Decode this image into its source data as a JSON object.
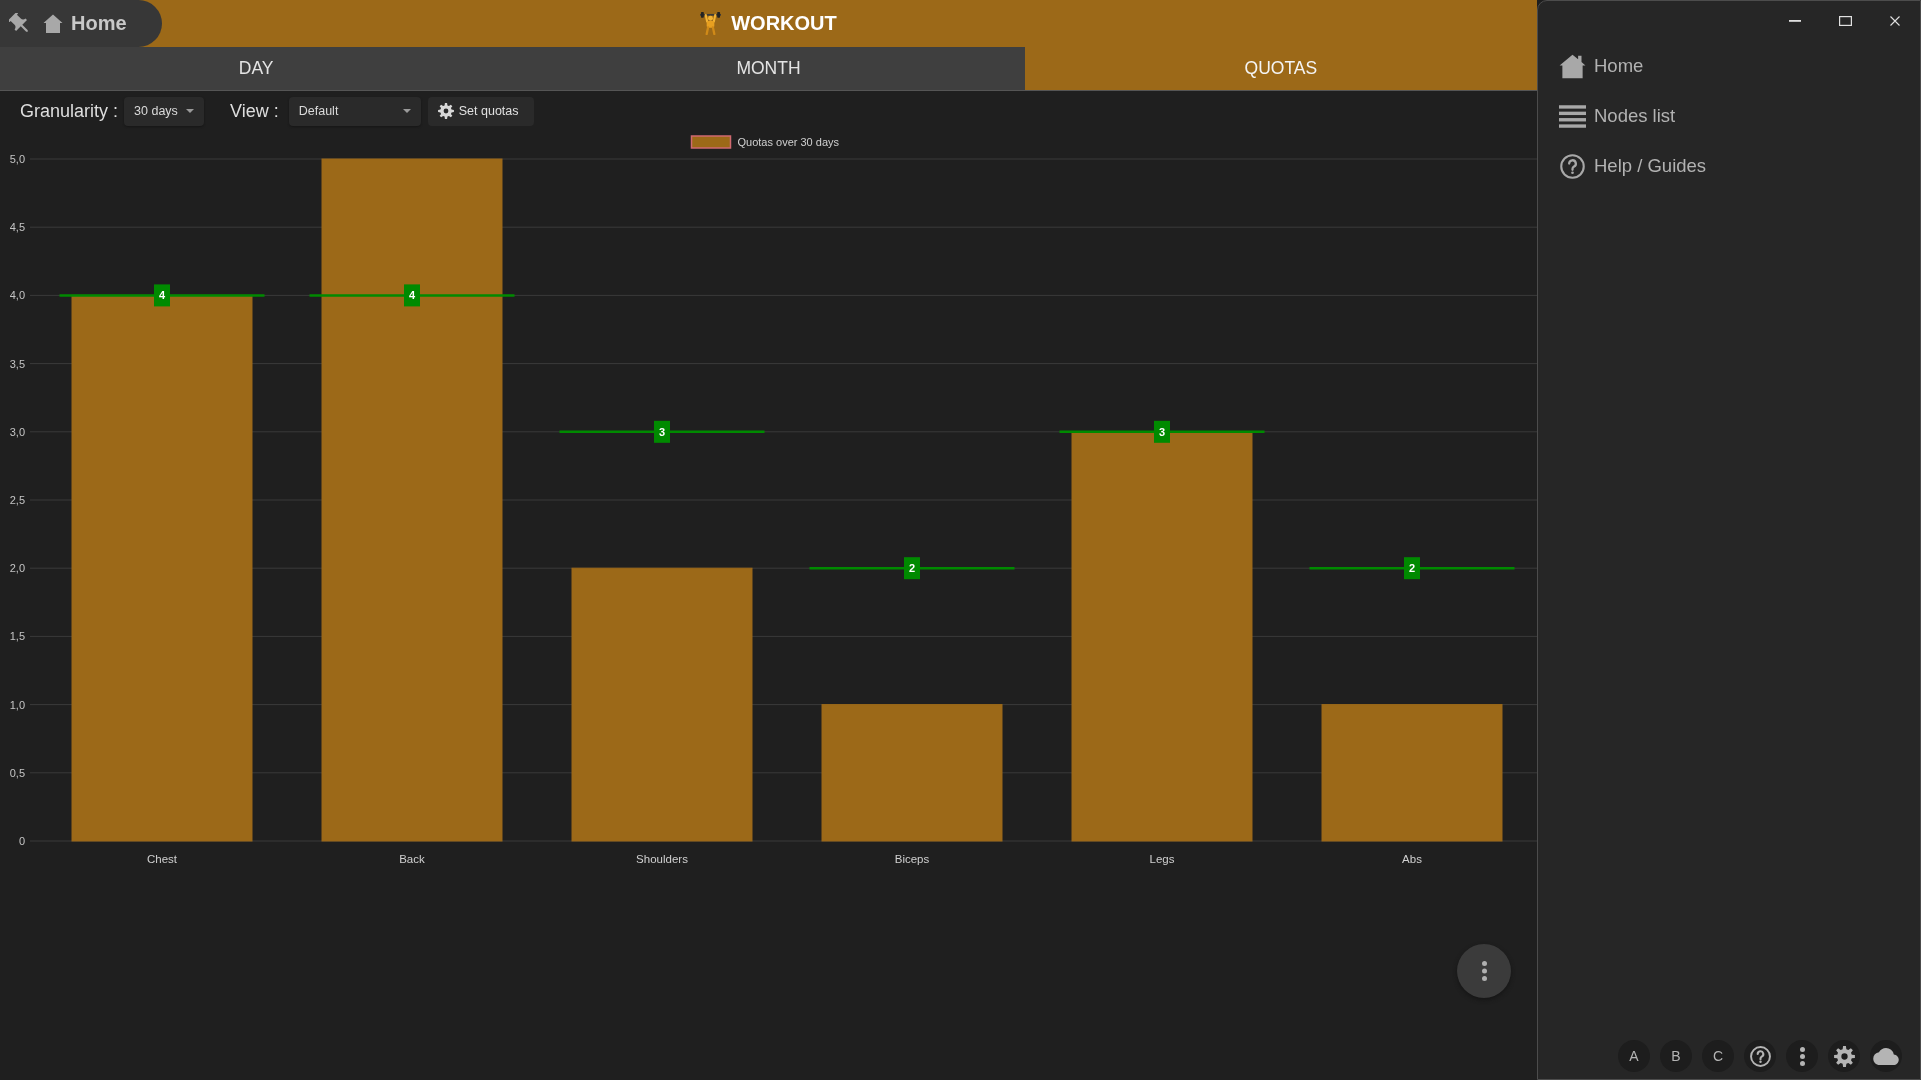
{
  "header": {
    "home_label": "Home",
    "title": "WORKOUT"
  },
  "tabs": [
    {
      "label": "DAY",
      "selected": false
    },
    {
      "label": "MONTH",
      "selected": false
    },
    {
      "label": "QUOTAS",
      "selected": true
    }
  ],
  "toolbar": {
    "granularity": {
      "label": "Granularity :",
      "value": "30 days"
    },
    "view": {
      "label": "View :",
      "value": "Default"
    },
    "set_quotas_button": "Set quotas"
  },
  "chart": {
    "chart_data": [
      {
        "type": "bar",
        "legend": "top",
        "grid": true,
        "categories": [
          "Chest",
          "Back",
          "Shoulders",
          "Biceps",
          "Legs",
          "Abs"
        ],
        "series": [
          {
            "name": "Quotas over 30 days",
            "color": "#9c6918",
            "values": [
              4,
              5,
              2,
              1,
              3,
              1
            ]
          },
          {
            "type": "scatter",
            "marker": "square",
            "color": "#008a00",
            "values": [
              4,
              4,
              3,
              2,
              3,
              2
            ],
            "value_labels": [
              "4",
              "4",
              "3",
              "2",
              "3",
              "2"
            ]
          }
        ],
        "ylim": [
          0,
          5
        ],
        "yticks": [
          {
            "value": 0,
            "label": "0"
          },
          {
            "value": 0.5,
            "label": "0,5"
          },
          {
            "value": 1,
            "label": "1,0"
          },
          {
            "value": 1.5,
            "label": "1,5"
          },
          {
            "value": 2,
            "label": "2,0"
          },
          {
            "value": 2.5,
            "label": "2,5"
          },
          {
            "value": 3,
            "label": "3,0"
          },
          {
            "value": 3.5,
            "label": "3,5"
          },
          {
            "value": 4,
            "label": "4,0"
          },
          {
            "value": 4.5,
            "label": "4,5"
          },
          {
            "value": 5,
            "label": "5,0"
          }
        ]
      }
    ]
  },
  "sidebar": {
    "items": [
      {
        "label": "Home"
      },
      {
        "label": "Nodes list"
      },
      {
        "label": "Help / Guides"
      }
    ],
    "footer_letters": [
      "A",
      "B",
      "C"
    ]
  }
}
